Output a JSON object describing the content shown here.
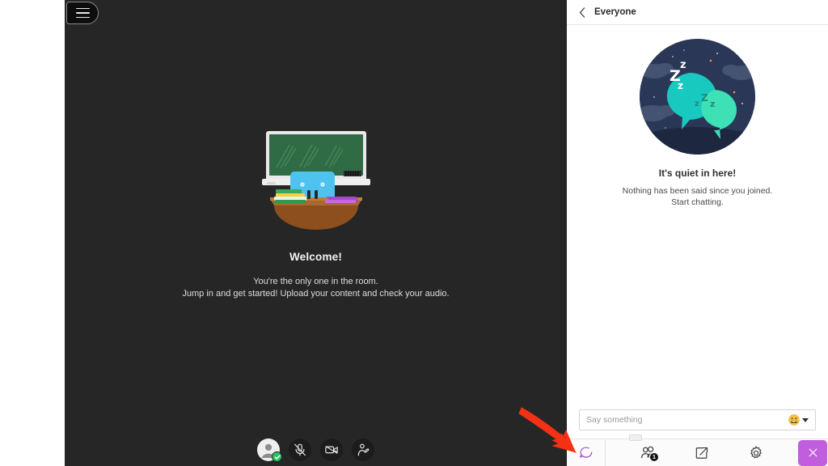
{
  "stage": {
    "menu_button": "menu",
    "welcome_title": "Welcome!",
    "welcome_line1": "You're the only one in the room.",
    "welcome_line2": "Jump in and get started! Upload your content and check your audio.",
    "illustration": "classroom-chalkboard-desk-books",
    "toolbar": [
      {
        "name": "user-avatar-button",
        "icon": "user-avatar-icon",
        "status": "online-check"
      },
      {
        "name": "microphone-mute-button",
        "icon": "microphone-muted-icon"
      },
      {
        "name": "camera-off-button",
        "icon": "camera-disabled-icon"
      },
      {
        "name": "raise-hand-button",
        "icon": "raise-hand-icon"
      }
    ]
  },
  "panel": {
    "header": {
      "back_label": "back",
      "title": "Everyone"
    },
    "empty_state": {
      "illustration": "sleeping-chat-bubbles-night-scene",
      "title": "It's quiet in here!",
      "line1": "Nothing has been said since you joined.",
      "line2": "Start chatting."
    },
    "composer": {
      "placeholder": "Say something",
      "value": "",
      "emoji_icon": "grinning-emoji-icon"
    },
    "bottom_bar": {
      "chat_tab_icon": "chat-bubble-icon",
      "items": [
        {
          "name": "participants-button",
          "icon": "participants-icon",
          "badge": "1"
        },
        {
          "name": "share-button",
          "icon": "share-export-icon",
          "badge": ""
        },
        {
          "name": "settings-button",
          "icon": "gear-icon",
          "badge": ""
        }
      ],
      "close_label": "×"
    }
  },
  "annotation": {
    "type": "red-arrow",
    "color": "#f43015",
    "points_to": "chat-bubble-icon"
  },
  "colors": {
    "stage_bg": "#262626",
    "panel_bg": "#ffffff",
    "accent_purple": "#c05ede",
    "chat_icon_purple": "#a855c7",
    "status_green": "#22c55e",
    "arrow_red": "#f43015"
  }
}
